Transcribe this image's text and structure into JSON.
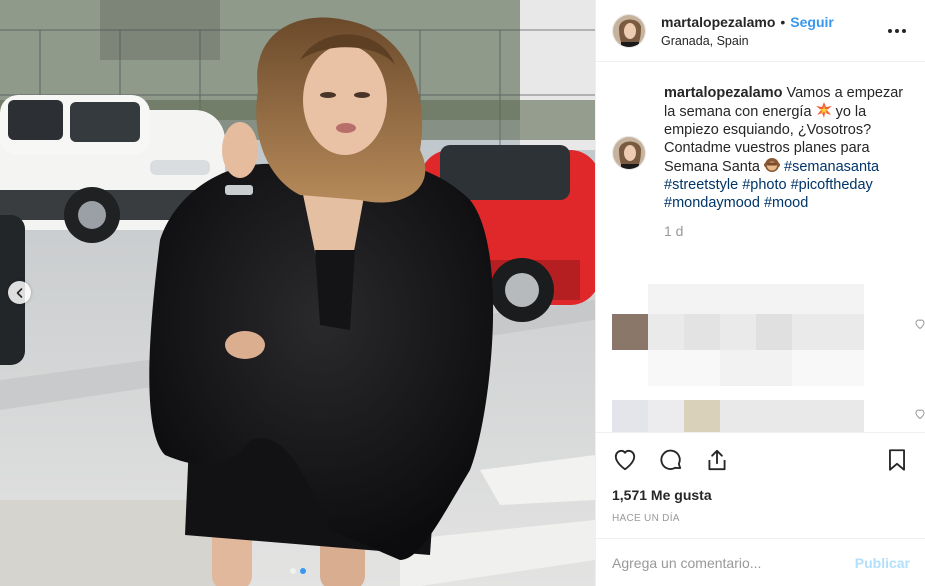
{
  "post": {
    "username": "martalopezalamo",
    "follow_label": "Seguir",
    "separator": "•",
    "location": "Granada, Spain",
    "more_icon": "more-options-icon"
  },
  "caption": {
    "username": "martalopezalamo",
    "text_1": "Vamos a empezar la semana con energía",
    "emoji_1": "collision-emoji",
    "text_2": "yo la empiezo esquiando, ¿Vosotros? Contadme vuestros planes para Semana Santa",
    "emoji_2": "monkey-emoji",
    "tags": [
      "#semanasanta",
      "#streetstyle",
      "#photo",
      "#picoftheday",
      "#mondaymood",
      "#mood"
    ],
    "relative_time": "1 d"
  },
  "actions": {
    "like_icon": "heart-icon",
    "comment_icon": "comment-icon",
    "share_icon": "share-icon",
    "save_icon": "bookmark-icon",
    "likes_text": "1,571 Me gusta",
    "timestamp": "HACE UN DÍA"
  },
  "comment_box": {
    "placeholder": "Agrega un comentario...",
    "publish_label": "Publicar"
  },
  "carousel": {
    "prev_icon": "chevron-left-icon",
    "slides_total": 2,
    "active_slide": 1
  },
  "colors": {
    "accent": "#3897f0",
    "hashtag": "#003569",
    "muted": "#999999",
    "publish_disabled": "#b2dffc"
  }
}
